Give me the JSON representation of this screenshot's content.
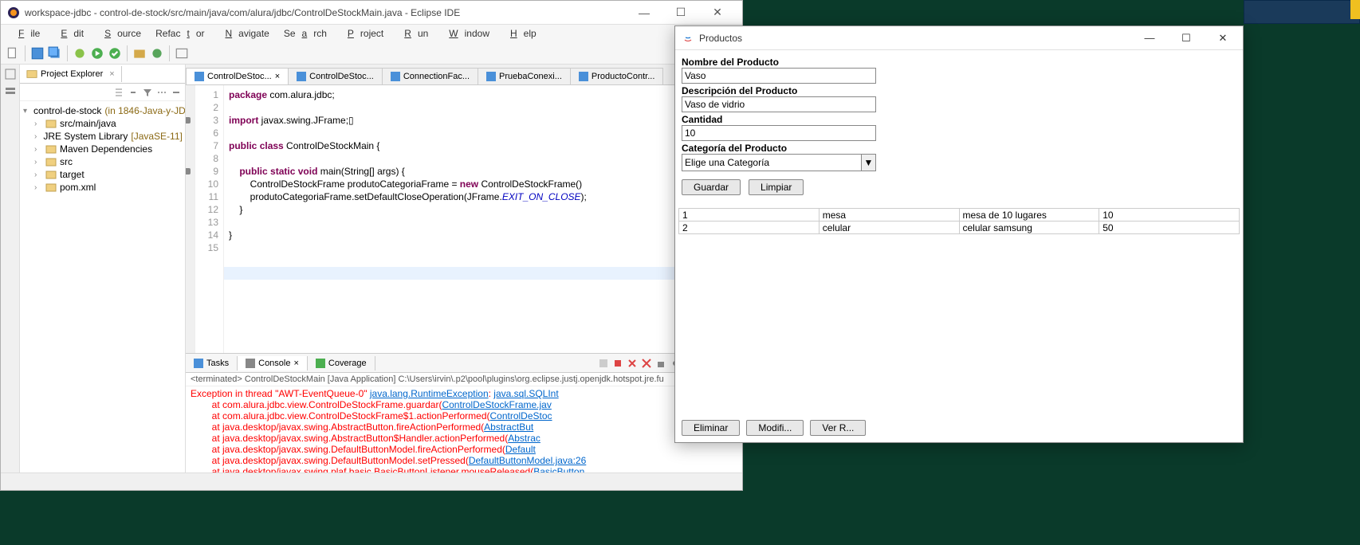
{
  "eclipse": {
    "title": "workspace-jdbc - control-de-stock/src/main/java/com/alura/jdbc/ControlDeStockMain.java - Eclipse IDE",
    "menu": [
      "File",
      "Edit",
      "Source",
      "Refactor",
      "Navigate",
      "Search",
      "Project",
      "Run",
      "Window",
      "Help"
    ],
    "project_explorer": {
      "title": "Project Explorer",
      "root": "control-de-stock",
      "root_suffix": " (in 1846-Java-y-JD",
      "items": [
        {
          "label": "src/main/java",
          "indent": 1
        },
        {
          "label": "JRE System Library",
          "suffix": " [JavaSE-11]",
          "indent": 1
        },
        {
          "label": "Maven Dependencies",
          "indent": 1
        },
        {
          "label": "src",
          "indent": 1
        },
        {
          "label": "target",
          "indent": 1
        },
        {
          "label": "pom.xml",
          "indent": 1
        }
      ]
    },
    "editor": {
      "tabs": [
        {
          "label": "ControlDeStoc...",
          "active": true,
          "close": true
        },
        {
          "label": "ControlDeStoc..."
        },
        {
          "label": "ConnectionFac..."
        },
        {
          "label": "PruebaConexi..."
        },
        {
          "label": "ProductoContr..."
        }
      ],
      "lines": [
        {
          "n": "1",
          "html": "<span class='kw'>package</span> com.alura.jdbc;"
        },
        {
          "n": "2",
          "html": ""
        },
        {
          "n": "3",
          "html": "<span class='kw'>import</span> javax.swing.JFrame;▯",
          "mark": true
        },
        {
          "n": "6",
          "html": ""
        },
        {
          "n": "7",
          "html": "<span class='kw'>public</span> <span class='kw'>class</span> ControlDeStockMain {"
        },
        {
          "n": "8",
          "html": ""
        },
        {
          "n": "9",
          "html": "    <span class='kw'>public</span> <span class='kw'>static</span> <span class='kw'>void</span> main(String[] args) {",
          "mark": true
        },
        {
          "n": "10",
          "html": "        ControlDeStockFrame produtoCategoriaFrame = <span class='kw'>new</span> ControlDeStockFrame()"
        },
        {
          "n": "11",
          "html": "        produtoCategoriaFrame.setDefaultCloseOperation(JFrame.<span class='fld'>EXIT_ON_CLOSE</span>);"
        },
        {
          "n": "12",
          "html": "    }"
        },
        {
          "n": "13",
          "html": ""
        },
        {
          "n": "14",
          "html": "}"
        },
        {
          "n": "15",
          "html": ""
        }
      ]
    },
    "console": {
      "tabs": [
        "Tasks",
        "Console",
        "Coverage"
      ],
      "active_tab": 1,
      "info": "<terminated> ControlDeStockMain [Java Application] C:\\Users\\irvin\\.p2\\pool\\plugins\\org.eclipse.justj.openjdk.hotspot.jre.fu",
      "lines": [
        "<span class='err'>Exception in thread \"AWT-EventQueue-0\" </span><span class='lnk'>java.lang.RuntimeException</span><span class='err'>: </span><span class='lnk'>java.sql.SQLInt</span>",
        "<span class='err'>        at com.alura.jdbc.view.ControlDeStockFrame.guardar(</span><span class='lnk'>ControlDeStockFrame.jav</span>",
        "<span class='err'>        at com.alura.jdbc.view.ControlDeStockFrame$1.actionPerformed(</span><span class='lnk'>ControlDeStoc</span>",
        "<span class='err'>        at java.desktop/javax.swing.AbstractButton.fireActionPerformed(</span><span class='lnk'>AbstractBut</span>",
        "<span class='err'>        at java.desktop/javax.swing.AbstractButton$Handler.actionPerformed(</span><span class='lnk'>Abstrac</span>",
        "<span class='err'>        at java.desktop/javax.swing.DefaultButtonModel.fireActionPerformed(</span><span class='lnk'>Default</span>",
        "<span class='err'>        at java.desktop/javax.swing.DefaultButtonModel.setPressed(</span><span class='lnk'>DefaultButtonModel.java:26</span>",
        "<span class='err'>        at java.desktop/javax.swing.plaf.basic.BasicButtonListener.mouseReleased(</span><span class='lnk'>BasicButton</span>"
      ]
    }
  },
  "productos": {
    "title": "Productos",
    "labels": {
      "nombre": "Nombre del Producto",
      "descripcion": "Descripción del Producto",
      "cantidad": "Cantidad",
      "categoria": "Categoría del Producto"
    },
    "values": {
      "nombre": "Vaso",
      "descripcion": "Vaso de vidrio",
      "cantidad": "10",
      "categoria": "Elige una Categoría"
    },
    "buttons": {
      "guardar": "Guardar",
      "limpiar": "Limpiar",
      "eliminar": "Eliminar",
      "modificar": "Modifi...",
      "ver": "Ver R..."
    },
    "rows": [
      {
        "id": "1",
        "nombre": "mesa",
        "desc": "mesa de 10 lugares",
        "cant": "10"
      },
      {
        "id": "2",
        "nombre": "celular",
        "desc": "celular samsung",
        "cant": "50"
      }
    ]
  }
}
